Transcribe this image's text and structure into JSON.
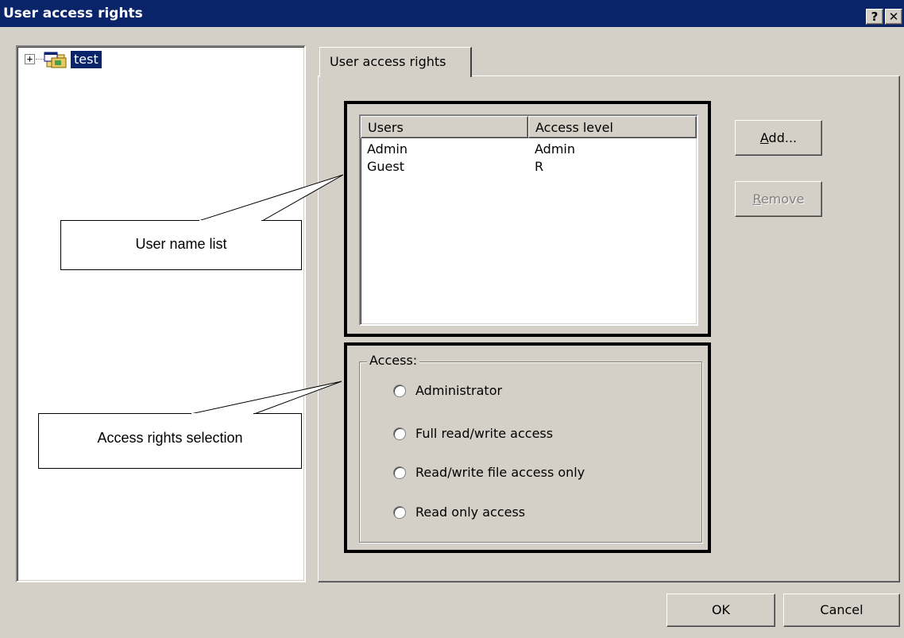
{
  "window": {
    "title": "User access rights",
    "help_button": "?",
    "close_button": "✕"
  },
  "tree": {
    "expander": "+",
    "node_label": "test"
  },
  "tab": {
    "label": "User access rights"
  },
  "user_list": {
    "columns": [
      "Users",
      "Access level"
    ],
    "rows": [
      {
        "user": "Admin",
        "level": "Admin"
      },
      {
        "user": "Guest",
        "level": "R"
      }
    ]
  },
  "buttons": {
    "add_mnemonic": "A",
    "add_rest": "dd...",
    "remove_mnemonic": "R",
    "remove_rest": "emove",
    "ok": "OK",
    "cancel": "Cancel"
  },
  "access_group": {
    "label": "Access:",
    "options": [
      "Administrator",
      "Full read/write access",
      "Read/write file access only",
      "Read only access"
    ]
  },
  "callouts": {
    "user_list": "User name list",
    "access_selection": "Access rights selection"
  },
  "colors": {
    "titlebar": "#0a246a",
    "face": "#d4d0c8",
    "selection": "#0a246a"
  }
}
